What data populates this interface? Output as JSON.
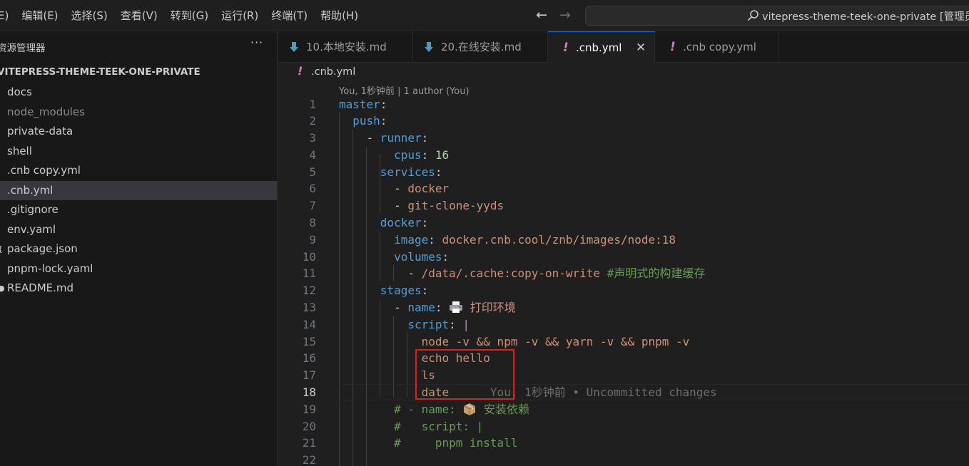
{
  "menu": [
    "E)",
    "编辑(E)",
    "选择(S)",
    "查看(V)",
    "转到(G)",
    "运行(R)",
    "终端(T)",
    "帮助(H)"
  ],
  "command_center": {
    "text": "vitepress-theme-teek-one-private [管理员]"
  },
  "sidebar": {
    "title": "资源管理器",
    "more": "···",
    "workspace": "VITEPRESS-THEME-TEEK-ONE-PRIVATE",
    "items": [
      {
        "label": "docs"
      },
      {
        "label": "node_modules"
      },
      {
        "label": "private-data"
      },
      {
        "label": "shell"
      },
      {
        "label": ".cnb copy.yml"
      },
      {
        "label": ".cnb.yml"
      },
      {
        "label": ".gitignore"
      },
      {
        "label": "env.yaml"
      },
      {
        "label": "package.json"
      },
      {
        "label": "pnpm-lock.yaml"
      },
      {
        "label": "README.md"
      }
    ],
    "selected": ".cnb.yml"
  },
  "tabs": [
    {
      "label": "10.本地安装.md",
      "icon": "markdown-icon"
    },
    {
      "label": "20.在线安装.md",
      "icon": "markdown-icon"
    },
    {
      "label": ".cnb.yml",
      "icon": "yaml-icon",
      "active": true,
      "close": "✕"
    },
    {
      "label": ".cnb copy.yml",
      "icon": "yaml-icon"
    }
  ],
  "breadcrumb": {
    "icon": "!",
    "file": ".cnb.yml"
  },
  "codelens": "You, 1秒钟前 | 1 author (You)",
  "editor": {
    "current_line": 18,
    "line_numbers": [
      "1",
      "2",
      "3",
      "4",
      "5",
      "6",
      "7",
      "8",
      "9",
      "10",
      "11",
      "12",
      "13",
      "14",
      "15",
      "16",
      "17",
      "18",
      "19",
      "20",
      "21",
      "22"
    ],
    "lines": {
      "l1": [
        "master",
        ":"
      ],
      "l2": [
        "push",
        ":"
      ],
      "l3": [
        "- ",
        "runner",
        ":"
      ],
      "l4": [
        "cpus",
        ": ",
        "16"
      ],
      "l5": [
        "services",
        ":"
      ],
      "l6": [
        "- ",
        "docker"
      ],
      "l7": [
        "- ",
        "git-clone-yyds"
      ],
      "l8": [
        "docker",
        ":"
      ],
      "l9": [
        "image",
        ": ",
        "docker.cnb.cool/znb/images/node:18"
      ],
      "l10": [
        "volumes",
        ":"
      ],
      "l11": [
        "- ",
        "/data/.cache:copy-on-write",
        " #声明式的构建缓存"
      ],
      "l12": [
        "stages",
        ":"
      ],
      "l13": [
        "- ",
        "name",
        ": ",
        "打印环境"
      ],
      "l14": [
        "script",
        ": ",
        "|"
      ],
      "l15": [
        "node -v && npm -v && yarn -v && pnpm -v"
      ],
      "l16": [
        "echo hello"
      ],
      "l17": [
        "ls"
      ],
      "l18": [
        "date",
        "You, 1秒钟前 • Uncommitted changes"
      ],
      "l19": [
        "# - name: ",
        "安装依赖"
      ],
      "l20": [
        "#   script: |"
      ],
      "l21": [
        "#     pnpm install"
      ],
      "l22": [
        ""
      ]
    }
  },
  "colors": {
    "keyword": "#569cd6",
    "string": "#ce9178",
    "number": "#b5cea8",
    "comment": "#6a9955",
    "highlight_box": "#e01e1e",
    "active_tab_border": "#0078d4"
  }
}
